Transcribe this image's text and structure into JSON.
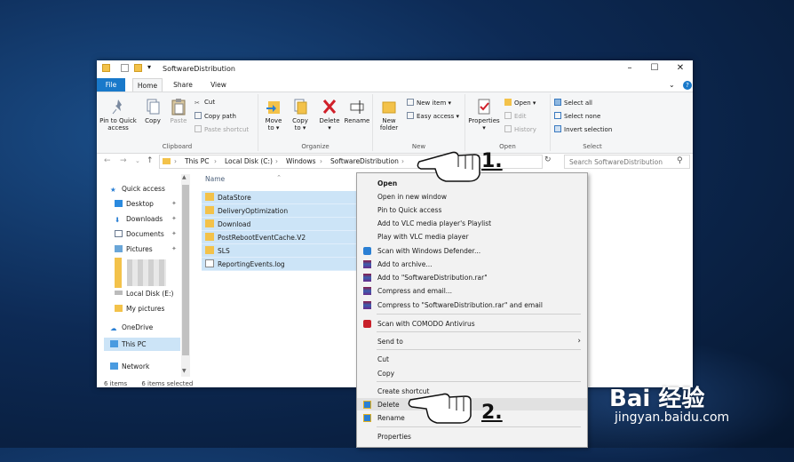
{
  "window": {
    "title": "SoftwareDistribution"
  },
  "tabs": [
    "File",
    "Home",
    "Share",
    "View"
  ],
  "ribbon": {
    "clipboard": {
      "pin": "Pin to Quick access",
      "copy": "Copy",
      "paste": "Paste",
      "cut": "Cut",
      "copy_path": "Copy path",
      "paste_shortcut": "Paste shortcut",
      "label": "Clipboard"
    },
    "organize": {
      "move": "Move to ▾",
      "copy": "Copy to ▾",
      "delete": "Delete ▾",
      "rename": "Rename",
      "label": "Organize"
    },
    "new": {
      "folder": "New folder",
      "item": "New item ▾",
      "easy": "Easy access ▾",
      "label": "New"
    },
    "open": {
      "properties": "Properties ▾",
      "open": "Open ▾",
      "edit": "Edit",
      "history": "History",
      "label": "Open"
    },
    "select": {
      "all": "Select all",
      "none": "Select none",
      "invert": "Invert selection",
      "label": "Select"
    }
  },
  "address": {
    "crumbs": [
      "This PC",
      "Local Disk (C:)",
      "Windows",
      "SoftwareDistribution"
    ],
    "search_placeholder": "Search SoftwareDistribution"
  },
  "nav": {
    "quick": "Quick access",
    "items": [
      "Desktop",
      "Downloads",
      "Documents",
      "Pictures"
    ],
    "localE": "Local Disk (E:)",
    "mypics": "My pictures",
    "onedrive": "OneDrive",
    "thispc": "This PC",
    "network": "Network"
  },
  "files": {
    "header": "Name",
    "rows": [
      "DataStore",
      "DeliveryOptimization",
      "Download",
      "PostRebootEventCache.V2",
      "SLS",
      "ReportingEvents.log"
    ]
  },
  "status": {
    "items": "6 items",
    "selected": "6 items selected"
  },
  "context_menu": [
    {
      "label": "Open",
      "bold": true
    },
    {
      "label": "Open in new window"
    },
    {
      "label": "Pin to Quick access"
    },
    {
      "label": "Add to VLC media player's Playlist"
    },
    {
      "label": "Play with VLC media player"
    },
    {
      "label": "Scan with Windows Defender..."
    },
    {
      "label": "Add to archive..."
    },
    {
      "label": "Add to \"SoftwareDistribution.rar\""
    },
    {
      "label": "Compress and email..."
    },
    {
      "label": "Compress to \"SoftwareDistribution.rar\" and email"
    },
    {
      "label": "Scan with COMODO Antivirus"
    },
    {
      "label": "Send to"
    },
    {
      "label": "Cut"
    },
    {
      "label": "Copy"
    },
    {
      "label": "Create shortcut"
    },
    {
      "label": "Delete"
    },
    {
      "label": "Rename"
    },
    {
      "label": "Properties"
    }
  ],
  "annotations": {
    "step1": "1.",
    "step2": "2."
  },
  "watermark": {
    "brand": "Bai 经验",
    "url": "jingyan.baidu.com"
  },
  "colors": {
    "accent": "#1979ca",
    "selection": "#cce4f7",
    "folder": "#f3c24a"
  }
}
